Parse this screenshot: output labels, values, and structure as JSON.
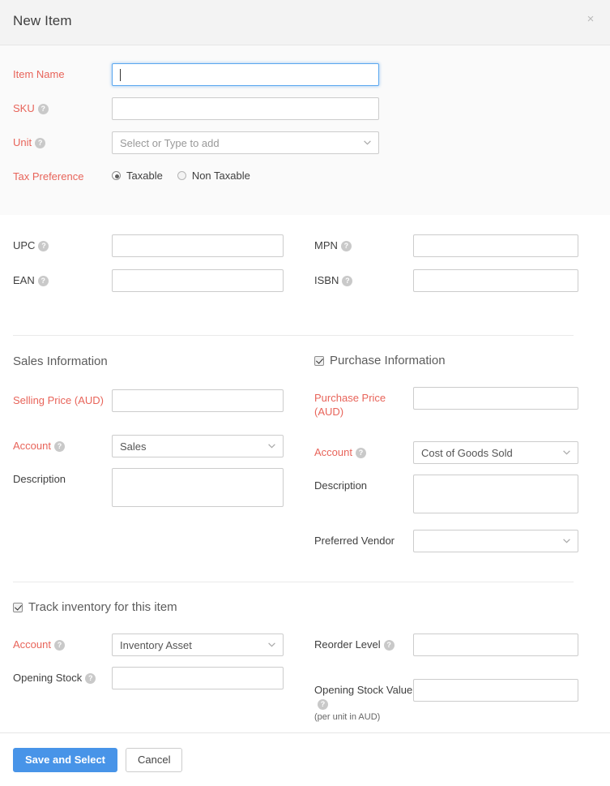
{
  "header": {
    "title": "New Item",
    "close_label": "×"
  },
  "top_section": {
    "item_name": {
      "label": "Item Name",
      "value": "",
      "required": true,
      "focused": true
    },
    "sku": {
      "label": "SKU",
      "value": "",
      "required": true,
      "help": "?"
    },
    "unit": {
      "label": "Unit",
      "required": true,
      "help": "?",
      "placeholder": "Select or Type to add",
      "value": ""
    },
    "tax_preference": {
      "label": "Tax Preference",
      "required": true,
      "options": [
        {
          "label": "Taxable",
          "selected": true
        },
        {
          "label": "Non Taxable",
          "selected": false
        }
      ]
    }
  },
  "identifiers": {
    "upc": {
      "label": "UPC",
      "help": "?",
      "value": ""
    },
    "ean": {
      "label": "EAN",
      "help": "?",
      "value": ""
    },
    "mpn": {
      "label": "MPN",
      "help": "?",
      "value": ""
    },
    "isbn": {
      "label": "ISBN",
      "help": "?",
      "value": ""
    }
  },
  "sales": {
    "heading": "Sales Information",
    "selling_price": {
      "label": "Selling Price (AUD)",
      "required": true,
      "value": ""
    },
    "account": {
      "label": "Account",
      "help": "?",
      "required": true,
      "value": "Sales"
    },
    "description": {
      "label": "Description",
      "value": ""
    }
  },
  "purchase": {
    "heading": "Purchase Information",
    "checked": true,
    "purchase_price": {
      "label": "Purchase Price (AUD)",
      "required": true,
      "value": ""
    },
    "account": {
      "label": "Account",
      "help": "?",
      "required": true,
      "value": "Cost of Goods Sold"
    },
    "description": {
      "label": "Description",
      "value": ""
    },
    "preferred_vendor": {
      "label": "Preferred Vendor",
      "value": ""
    }
  },
  "inventory": {
    "heading": "Track inventory for this item",
    "checked": true,
    "account": {
      "label": "Account",
      "help": "?",
      "required": true,
      "value": "Inventory Asset"
    },
    "opening_stock": {
      "label": "Opening Stock",
      "help": "?",
      "value": ""
    },
    "reorder_level": {
      "label": "Reorder Level",
      "help": "?",
      "value": ""
    },
    "opening_stock_value": {
      "label": "Opening Stock Value",
      "help": "?",
      "note": "(per unit in AUD)",
      "value": ""
    }
  },
  "footer": {
    "save_label": "Save and Select",
    "cancel_label": "Cancel"
  },
  "colors": {
    "required_label": "#e8645a",
    "primary_button": "#4894e8",
    "focus_border": "#5aa7ef",
    "header_bg": "#f3f3f3",
    "top_section_bg": "#fafafa"
  }
}
